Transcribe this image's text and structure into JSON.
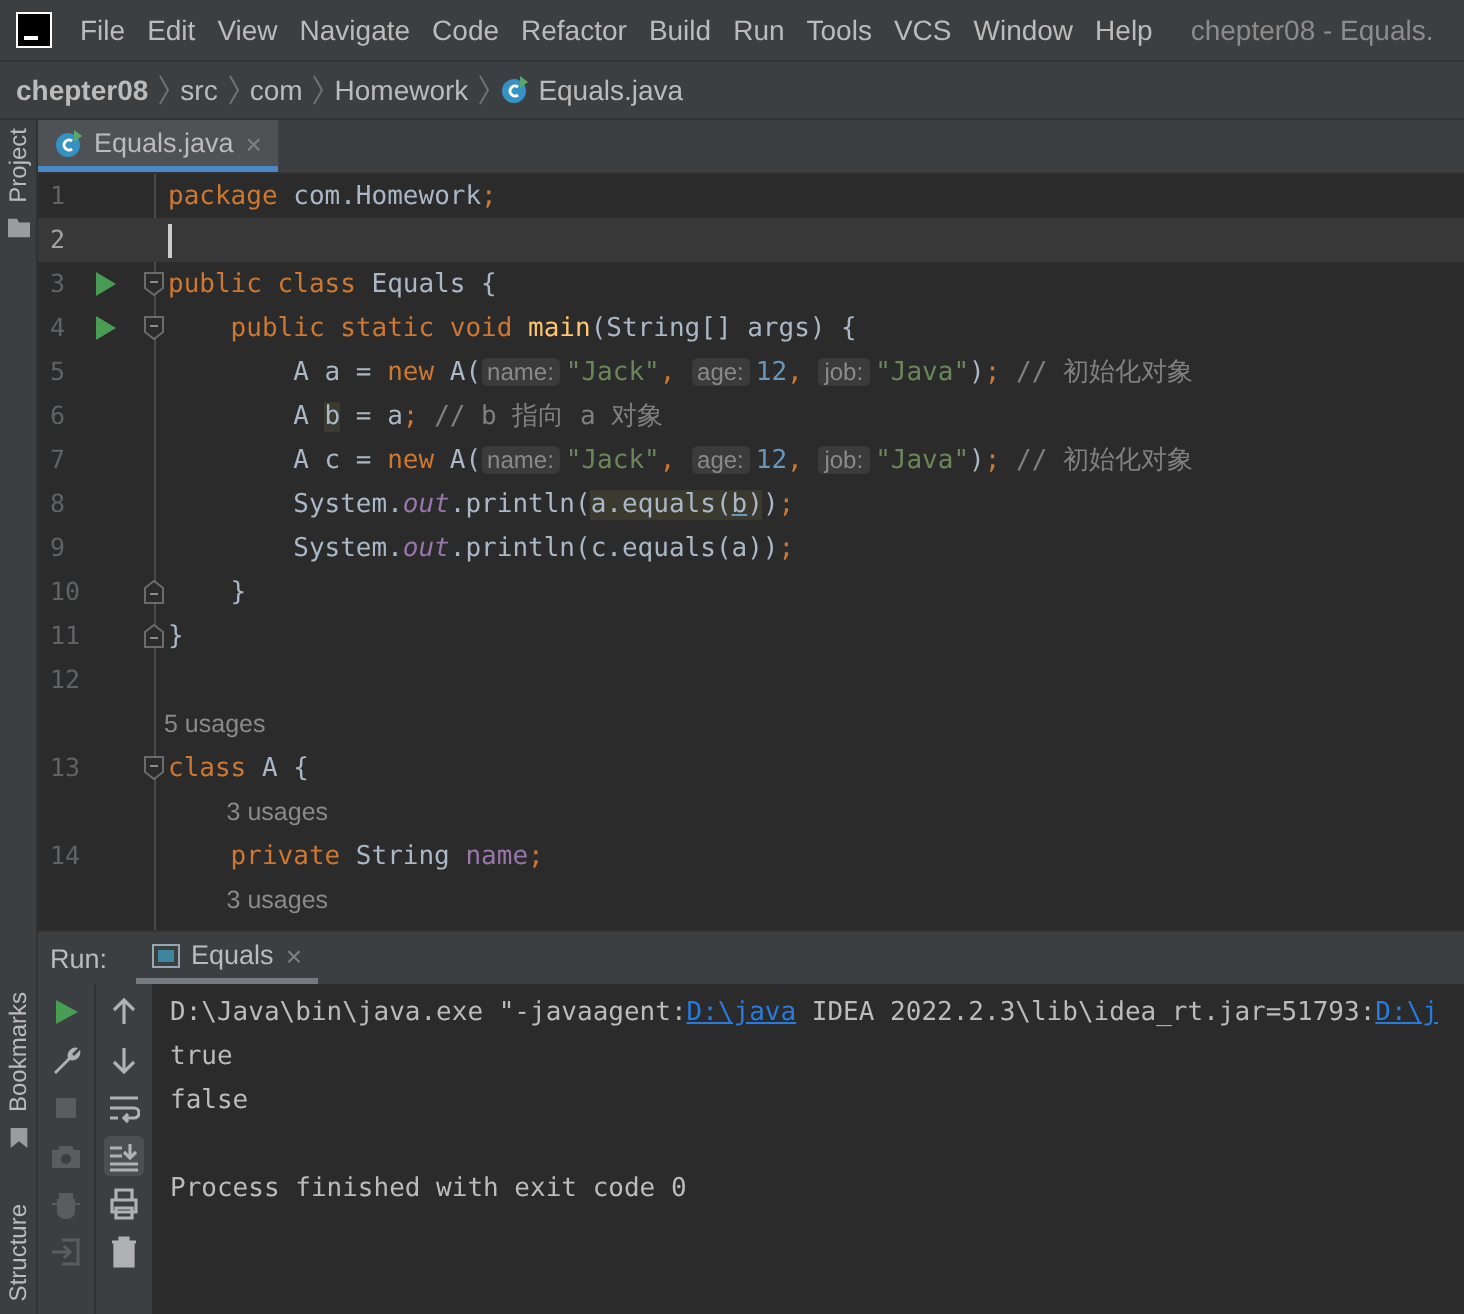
{
  "menu": {
    "items": [
      "File",
      "Edit",
      "View",
      "Navigate",
      "Code",
      "Refactor",
      "Build",
      "Run",
      "Tools",
      "VCS",
      "Window",
      "Help"
    ],
    "title": "chepter08 - Equals."
  },
  "breadcrumb": [
    "chepter08",
    "src",
    "com",
    "Homework",
    "Equals.java"
  ],
  "side_tabs": {
    "top": "Project",
    "bottom": [
      "Bookmarks",
      "Structure"
    ]
  },
  "editor_tabs": [
    {
      "label": "Equals.java",
      "close": "×",
      "selected": true
    }
  ],
  "code_lines": [
    {
      "number": "1",
      "current": false,
      "runnable": false,
      "fold_start": false,
      "fold_end": false,
      "tokens": [
        {
          "text": "package ",
          "kind": "keyword"
        },
        {
          "text": "com.Homework",
          "kind": "plain"
        },
        {
          "text": ";",
          "kind": "keyword"
        }
      ]
    },
    {
      "number": "2",
      "current": true,
      "runnable": false,
      "fold_start": false,
      "fold_end": false
    },
    {
      "number": "3",
      "current": false,
      "runnable": true,
      "fold_start": true,
      "fold_end": false,
      "tokens": [
        {
          "text": "public class ",
          "kind": "keyword"
        },
        {
          "text": "Equals {",
          "kind": "plain"
        }
      ]
    },
    {
      "number": "4",
      "current": false,
      "runnable": true,
      "fold_start": true,
      "fold_end": false,
      "tokens": [
        {
          "text": "    public static void ",
          "kind": "keyword"
        },
        {
          "text": "main",
          "kind": "method"
        },
        {
          "text": "(String[] args) {",
          "kind": "plain"
        }
      ]
    },
    {
      "number": "5",
      "current": false,
      "runnable": false,
      "fold_start": false,
      "fold_end": false,
      "tokens": [
        {
          "text": "        A a = ",
          "kind": "plain"
        },
        {
          "text": "new ",
          "kind": "keyword"
        },
        {
          "text": "A(",
          "kind": "plain"
        },
        {
          "text": "name:",
          "kind": "hint"
        },
        {
          "text": "\"Jack\"",
          "kind": "string"
        },
        {
          "text": ", ",
          "kind": "keyword"
        },
        {
          "text": "age:",
          "kind": "hint"
        },
        {
          "text": "12",
          "kind": "number"
        },
        {
          "text": ", ",
          "kind": "keyword"
        },
        {
          "text": "job:",
          "kind": "hint"
        },
        {
          "text": "\"Java\"",
          "kind": "string"
        },
        {
          "text": ")",
          "kind": "plain"
        },
        {
          "text": "; ",
          "kind": "keyword"
        },
        {
          "text": "// 初始化对象",
          "kind": "comment"
        }
      ]
    },
    {
      "number": "6",
      "current": false,
      "runnable": false,
      "fold_start": false,
      "fold_end": false,
      "tokens": [
        {
          "text": "        A ",
          "kind": "plain"
        },
        {
          "text": "b",
          "kind": "match"
        },
        {
          "text": " = a",
          "kind": "plain"
        },
        {
          "text": "; ",
          "kind": "keyword"
        },
        {
          "text": "// b 指向 a 对象",
          "kind": "comment"
        }
      ]
    },
    {
      "number": "7",
      "current": false,
      "runnable": false,
      "fold_start": false,
      "fold_end": false,
      "tokens": [
        {
          "text": "        A c = ",
          "kind": "plain"
        },
        {
          "text": "new ",
          "kind": "keyword"
        },
        {
          "text": "A(",
          "kind": "plain"
        },
        {
          "text": "name:",
          "kind": "hint"
        },
        {
          "text": "\"Jack\"",
          "kind": "string"
        },
        {
          "text": ", ",
          "kind": "keyword"
        },
        {
          "text": "age:",
          "kind": "hint"
        },
        {
          "text": "12",
          "kind": "number"
        },
        {
          "text": ", ",
          "kind": "keyword"
        },
        {
          "text": "job:",
          "kind": "hint"
        },
        {
          "text": "\"Java\"",
          "kind": "string"
        },
        {
          "text": ")",
          "kind": "plain"
        },
        {
          "text": "; ",
          "kind": "keyword"
        },
        {
          "text": "// 初始化对象",
          "kind": "comment"
        }
      ]
    },
    {
      "number": "8",
      "current": false,
      "runnable": false,
      "fold_start": false,
      "fold_end": false,
      "tokens": [
        {
          "text": "        System.",
          "kind": "plain"
        },
        {
          "text": "out",
          "kind": "field"
        },
        {
          "text": ".println(",
          "kind": "plain"
        },
        {
          "text": "a.equals(",
          "kind": "match"
        },
        {
          "text": "b",
          "kind": "matchref"
        },
        {
          "text": ")",
          "kind": "match"
        },
        {
          "text": ")",
          "kind": "plain"
        },
        {
          "text": ";",
          "kind": "keyword"
        }
      ]
    },
    {
      "number": "9",
      "current": false,
      "runnable": false,
      "fold_start": false,
      "fold_end": false,
      "tokens": [
        {
          "text": "        System.",
          "kind": "plain"
        },
        {
          "text": "out",
          "kind": "field"
        },
        {
          "text": ".println(c.equals(a))",
          "kind": "plain"
        },
        {
          "text": ";",
          "kind": "keyword"
        }
      ]
    },
    {
      "number": "10",
      "current": false,
      "runnable": false,
      "fold_start": false,
      "fold_end": true,
      "tokens": [
        {
          "text": "    }",
          "kind": "plain"
        }
      ]
    },
    {
      "number": "11",
      "current": false,
      "runnable": false,
      "fold_start": false,
      "fold_end": true,
      "tokens": [
        {
          "text": "}",
          "kind": "plain"
        }
      ]
    },
    {
      "number": "12",
      "current": false,
      "runnable": false,
      "fold_start": false,
      "fold_end": false
    },
    {
      "number": "13",
      "current": false,
      "runnable": false,
      "fold_start": true,
      "fold_end": false,
      "usages": "5 usages",
      "tokens": [
        {
          "text": "class ",
          "kind": "keyword"
        },
        {
          "text": "A {",
          "kind": "plain"
        }
      ]
    },
    {
      "number": "14",
      "current": false,
      "runnable": false,
      "fold_start": false,
      "fold_end": false,
      "usages": "3 usages",
      "tokens": [
        {
          "text": "    private ",
          "kind": "keyword"
        },
        {
          "text": "String ",
          "kind": "plain"
        },
        {
          "text": "name",
          "kind": "fieldplain"
        },
        {
          "text": ";",
          "kind": "keyword"
        }
      ]
    }
  ],
  "trailing_usages": "3 usages",
  "run_panel": {
    "label": "Run:",
    "tabs": [
      {
        "label": "Equals",
        "close": "×",
        "selected": true
      }
    ],
    "tools_left": [
      {
        "kind": "run",
        "disabled": false
      },
      {
        "kind": "wrench",
        "disabled": false
      },
      {
        "kind": "stop",
        "disabled": true
      },
      {
        "kind": "camera",
        "disabled": true
      },
      {
        "kind": "bug",
        "disabled": true
      },
      {
        "kind": "login",
        "disabled": true
      }
    ],
    "tools_right": [
      {
        "kind": "up",
        "selected": false
      },
      {
        "kind": "down",
        "selected": false
      },
      {
        "kind": "wrap",
        "selected": false
      },
      {
        "kind": "scroll",
        "selected": true
      },
      {
        "kind": "print",
        "selected": false
      },
      {
        "kind": "trash",
        "selected": false
      }
    ],
    "console": [
      [
        {
          "text": "D:\\Java\\bin\\java.exe \"-javaagent:",
          "kind": "text"
        },
        {
          "text": "D:\\java",
          "kind": "link"
        },
        {
          "text": " IDEA 2022.2.3\\lib\\idea_rt.jar=51793:",
          "kind": "text"
        },
        {
          "text": "D:\\j",
          "kind": "link"
        }
      ],
      [
        {
          "text": "true",
          "kind": "text"
        }
      ],
      [
        {
          "text": "false",
          "kind": "text"
        }
      ],
      [
        {
          "text": "Process finished with exit code 0",
          "kind": "status"
        }
      ]
    ]
  }
}
